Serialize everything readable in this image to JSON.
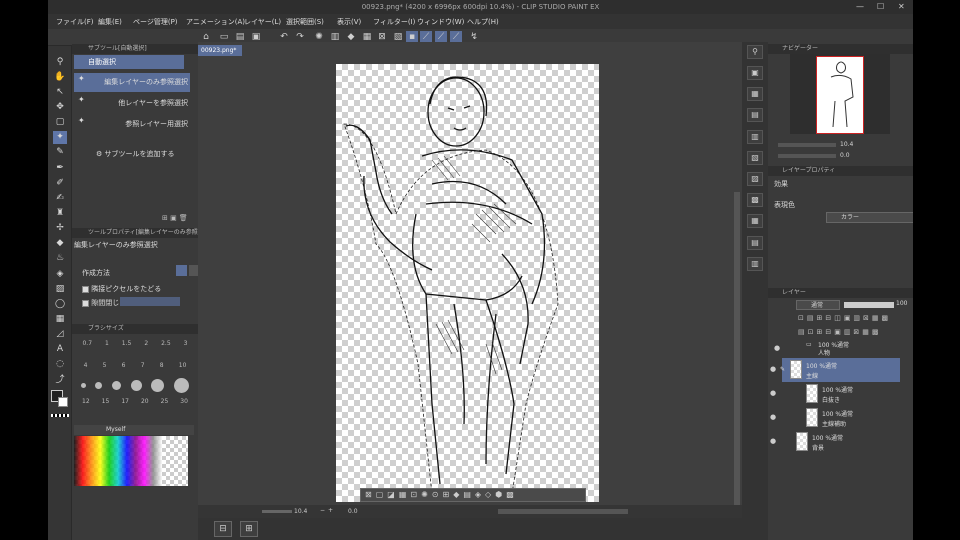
{
  "titlebar": {
    "title": "00923.png* (4200 x 6996px 600dpi 10.4%) - CLIP STUDIO PAINT EX",
    "min": "—",
    "max": "☐",
    "close": "✕"
  },
  "menu": [
    {
      "label": "ファイル(F)"
    },
    {
      "label": "編集(E)"
    },
    {
      "label": "ページ管理(P)"
    },
    {
      "label": "アニメーション(A)"
    },
    {
      "label": "レイヤー(L)"
    },
    {
      "label": "選択範囲(S)"
    },
    {
      "label": "表示(V)"
    },
    {
      "label": "フィルター(I)"
    },
    {
      "label": "ウィンドウ(W)"
    },
    {
      "label": "ヘルプ(H)"
    }
  ],
  "subtool": {
    "header": "サブツール[自動選択]",
    "group_tab": "自動選択",
    "items": [
      {
        "label": "編集レイヤーのみ参照選択",
        "selected": true
      },
      {
        "label": "他レイヤーを参照選択",
        "selected": false
      },
      {
        "label": "参照レイヤー用選択",
        "selected": false
      }
    ],
    "add_label": "サブツールを追加する"
  },
  "toolprop": {
    "header": "ツールプロパティ[編集レイヤーのみ参照",
    "title": "編集レイヤーのみ参照選択",
    "mode_label": "作成方法",
    "opt1": "隣接ピクセルをたどる",
    "opt2": "隙間閉じ"
  },
  "brushsize": {
    "header": "ブラシサイズ",
    "row1": [
      "0.7",
      "1",
      "1.5",
      "2",
      "2.5",
      "3"
    ],
    "row2": [
      "4",
      "5",
      "6",
      "7",
      "8",
      "10"
    ],
    "row3": [
      "12",
      "15",
      "17",
      "20",
      "25",
      "30"
    ]
  },
  "color": {
    "set_name": "Myself"
  },
  "document": {
    "tab": "00923.png*",
    "zoom": "10.4",
    "angle": "0.0"
  },
  "navigator": {
    "header": "ナビゲーター",
    "zoom": "10.4",
    "angle": "0.0"
  },
  "layerprop": {
    "header": "レイヤープロパティ",
    "effect": "効果",
    "express": "表現色",
    "color_value": "カラー"
  },
  "layer": {
    "header": "レイヤー",
    "blend": "通常",
    "opacity": "100",
    "items": [
      {
        "pct": "100 %通常",
        "name": "人物",
        "selected": false,
        "folder": true
      },
      {
        "pct": "100 %通常",
        "name": "主線",
        "selected": true,
        "folder": false
      },
      {
        "pct": "100 %通常",
        "name": "白抜き",
        "selected": false,
        "folder": false
      },
      {
        "pct": "100 %通常",
        "name": "主線補助",
        "selected": false,
        "folder": false
      },
      {
        "pct": "100 %通常",
        "name": "背景",
        "selected": false,
        "folder": false
      }
    ]
  },
  "colors": {
    "accent": "#5a6e99",
    "panel": "#3a3a3a",
    "dark": "#2f2f2f"
  }
}
